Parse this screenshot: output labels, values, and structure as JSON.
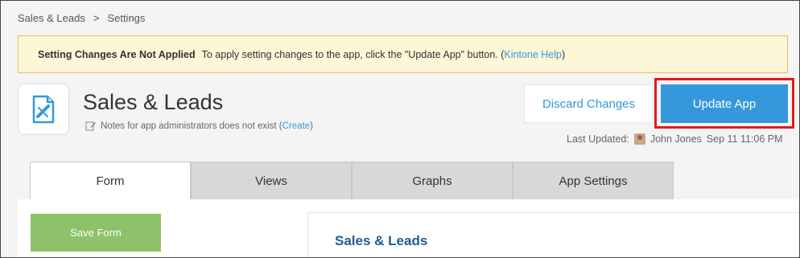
{
  "breadcrumb": {
    "app": "Sales & Leads",
    "separator": ">",
    "current": "Settings"
  },
  "notice": {
    "title": "Setting Changes Are Not Applied",
    "message": "To apply setting changes to the app, click the \"Update App\" button. (",
    "link": "Kintone Help",
    "suffix": ")"
  },
  "app": {
    "icon": "app-document-pen-icon",
    "title": "Sales & Leads",
    "notes_text": "Notes for app administrators does not exist (",
    "notes_link": "Create",
    "notes_suffix": ")"
  },
  "actions": {
    "discard_label": "Discard Changes",
    "update_label": "Update App"
  },
  "last_updated": {
    "label": "Last Updated:",
    "user": "John Jones",
    "time": "Sep 11 11:06 PM"
  },
  "tabs": [
    {
      "label": "Form",
      "active": true
    },
    {
      "label": "Views",
      "active": false
    },
    {
      "label": "Graphs",
      "active": false
    },
    {
      "label": "App Settings",
      "active": false
    }
  ],
  "form": {
    "save_label": "Save Form",
    "title": "Sales & Leads"
  },
  "colors": {
    "accent": "#3498db",
    "highlight": "#e01b1b",
    "save": "#8dc26a",
    "notice_bg": "#fdf6d7"
  }
}
